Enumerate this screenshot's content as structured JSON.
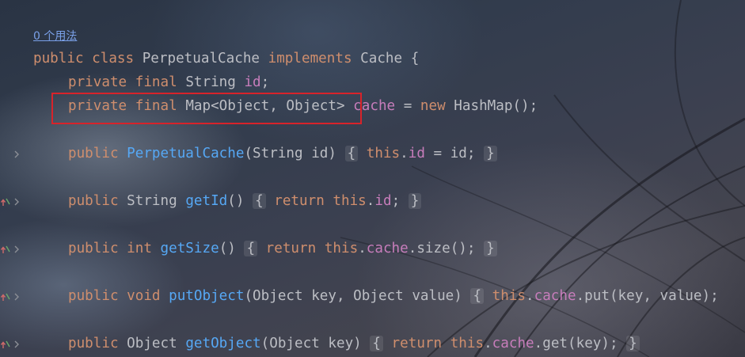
{
  "usages_hint": "0 个用法",
  "code": {
    "class_decl": {
      "kw_public": "public",
      "kw_class": "class",
      "class_name": "PerpetualCache",
      "kw_implements": "implements",
      "iface": "Cache {"
    },
    "field_id": {
      "kw_private": "private",
      "kw_final": "final",
      "type": "String",
      "name": "id",
      "end": ";"
    },
    "field_cache": {
      "kw_private": "private",
      "kw_final": "final",
      "type": "Map<Object, Object>",
      "name": "cache",
      "eq": " = ",
      "kw_new": "new",
      "rest": " HashMap();"
    },
    "ctor": {
      "kw_public": "public",
      "name": "PerpetualCache",
      "params": "(String id)",
      "open": "{",
      "kw_this": "this",
      "dot": ".",
      "field": "id",
      "rest": " = id;",
      "close": "}"
    },
    "get_id": {
      "kw_public": "public",
      "ret": "String",
      "name": "getId",
      "params": "()",
      "open": "{",
      "kw_return": "return",
      "kw_this": "this",
      "dot": ".",
      "field": "id",
      "semi": ";",
      "close": "}"
    },
    "get_size": {
      "kw_public": "public",
      "kw_int": "int",
      "name": "getSize",
      "params": "()",
      "open": "{",
      "kw_return": "return",
      "kw_this": "this",
      "dot": ".",
      "field": "cache",
      "rest": ".size();",
      "close": "}"
    },
    "put_object": {
      "kw_public": "public",
      "kw_void": "void",
      "name": "putObject",
      "params": "(Object key, Object value)",
      "open": "{",
      "kw_this": "this",
      "dot": ".",
      "field": "cache",
      "rest": ".put(key, value);"
    },
    "get_object": {
      "kw_public": "public",
      "ret": "Object",
      "name": "getObject",
      "params": "(Object key)",
      "open": "{",
      "kw_return": "return",
      "kw_this": "this",
      "dot": ".",
      "field": "cache",
      "rest": ".get(key);",
      "close": "}"
    }
  },
  "colors": {
    "keyword": "#cf8e6d",
    "field": "#c77dbb",
    "function": "#56a8f5",
    "plain": "#bcbec4",
    "link": "#7aa0e8",
    "highlight_border": "#d8232a"
  },
  "icons": {
    "fold_chevron": "chevron-right-icon",
    "override_marker": "override-arrow-icon"
  }
}
